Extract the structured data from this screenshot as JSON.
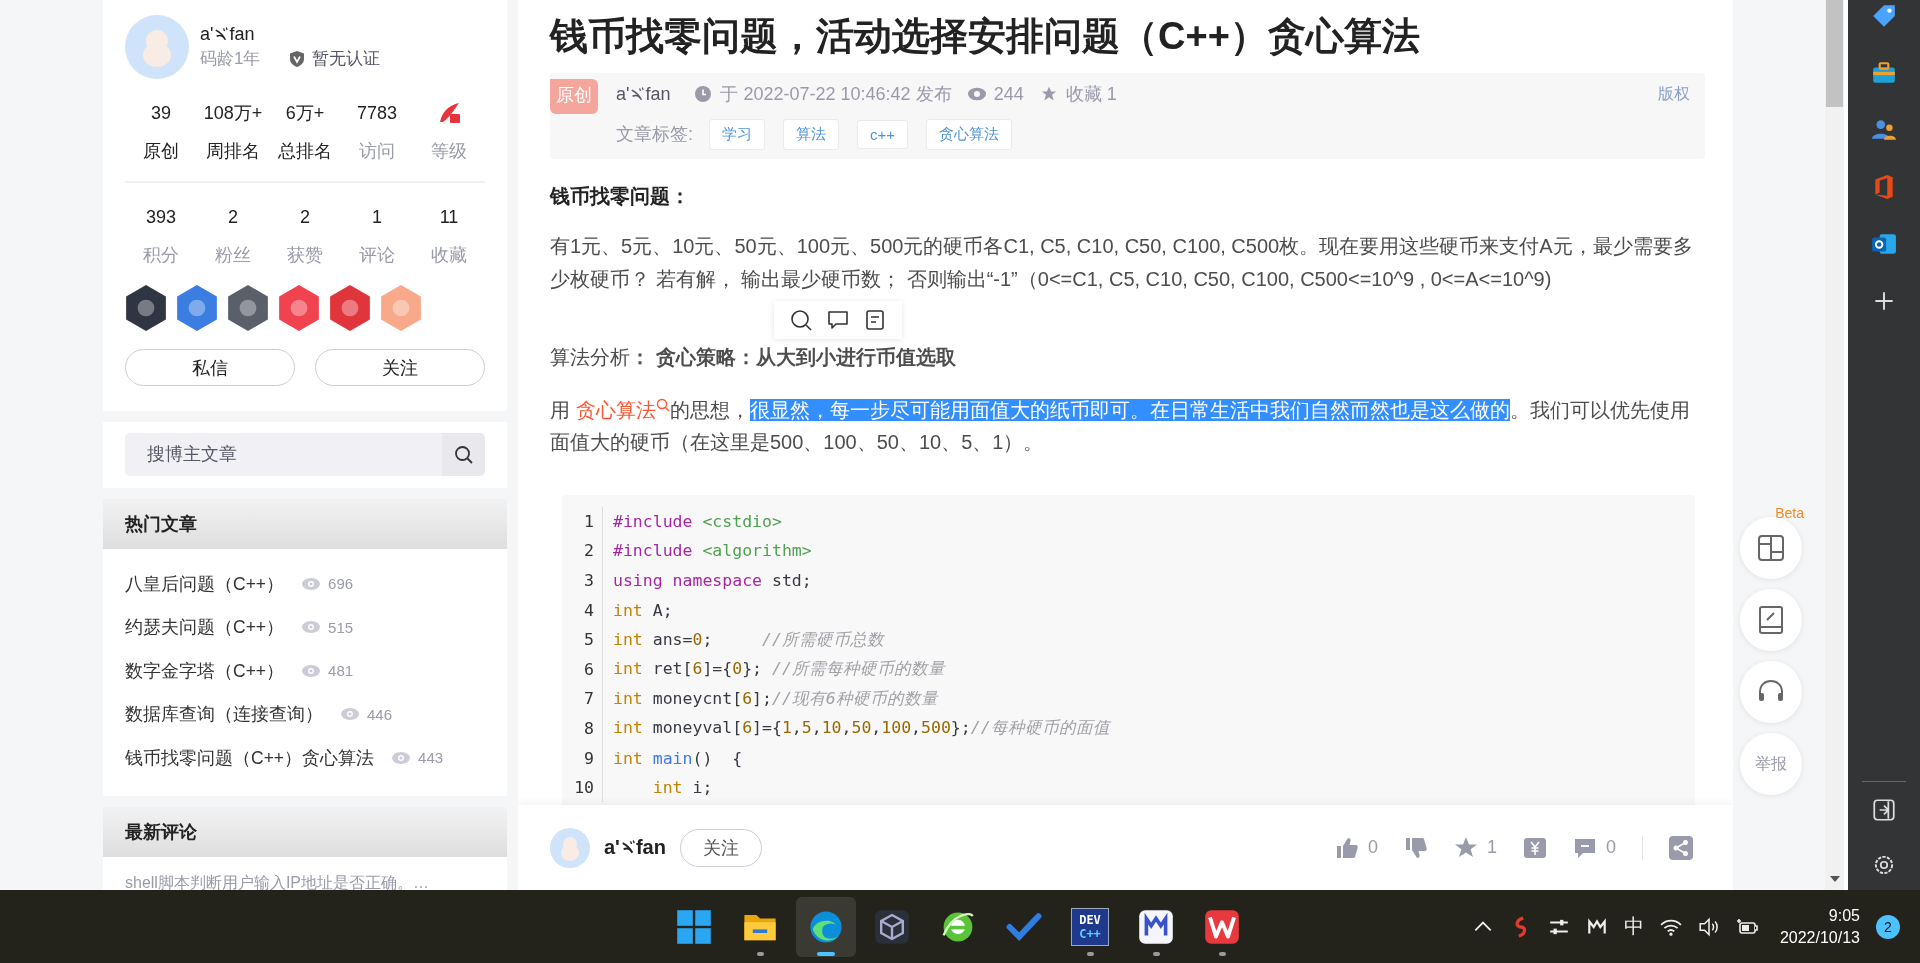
{
  "sidebar": {
    "profile": {
      "name": {
        "prefix": "a'",
        "suffix": "fan"
      },
      "code_age": "码龄1年",
      "certification": "暂无认证",
      "stats": [
        {
          "value": "39",
          "label": "原创",
          "linked": true
        },
        {
          "value": "108万+",
          "label": "周排名",
          "linked": true
        },
        {
          "value": "6万+",
          "label": "总排名",
          "linked": true
        },
        {
          "value": "7783",
          "label": "访问",
          "linked": false
        },
        {
          "kind": "level",
          "label": "等级",
          "linked": false
        }
      ],
      "stats2": [
        {
          "value": "393",
          "label": "积分"
        },
        {
          "value": "2",
          "label": "粉丝"
        },
        {
          "value": "2",
          "label": "获赞"
        },
        {
          "value": "1",
          "label": "评论"
        },
        {
          "value": "11",
          "label": "收藏"
        }
      ],
      "badges": [
        {
          "color": "#2f3542"
        },
        {
          "color": "#3b7de0"
        },
        {
          "color": "#5a5f6a"
        },
        {
          "color": "#f0434f"
        },
        {
          "color": "#e0353b"
        },
        {
          "color": "#f7a98a"
        }
      ],
      "buttons": [
        "私信",
        "关注"
      ]
    },
    "search": {
      "placeholder": "搜博主文章"
    },
    "hot": {
      "title": "热门文章",
      "items": [
        {
          "title": "八皇后问题（C++）",
          "views": "696"
        },
        {
          "title": "约瑟夫问题（C++）",
          "views": "515"
        },
        {
          "title": "数字金字塔（C++）",
          "views": "481"
        },
        {
          "title": "数据库查询（连接查询）",
          "views": "446"
        },
        {
          "title": "钱币找零问题（C++）贪心算法",
          "views": "443"
        }
      ]
    },
    "comments": {
      "title": "最新评论",
      "items": [
        "shell脚本判断用户输入IP地址是否正确。…"
      ]
    }
  },
  "article": {
    "title": "钱币找零问题，活动选择安排问题（C++）贪心算法",
    "badge": "原创",
    "author": {
      "prefix": "a'",
      "suffix": "fan"
    },
    "published": "于 2022-07-22 10:46:42 发布",
    "views": "244",
    "favorites": "收藏 1",
    "copyright": "版权",
    "tags_label": "文章标签:",
    "tags": [
      "学习",
      "算法",
      "c++",
      "贪心算法"
    ],
    "heading": "钱币找零问题：",
    "paragraph": "有1元、5元、10元、50元、100元、500元的硬币各C1, C5, C10, C50, C100, C500枚。现在要用这些硬币来支付A元，最少需要多少枚硬币？ 若有解， 输出最少硬币数； 否则输出“-1”（0<=C1, C5, C10, C50, C100, C500<=10^9 , 0<=A<=10^9)",
    "analysis": "算法分析**：  贪心策略：从大到小进行币值选取**",
    "idea": [
      {
        "kind": "text",
        "text": "用 ",
        "selected": false
      },
      {
        "kind": "link",
        "text": "贪心算法",
        "selected": false
      },
      {
        "kind": "text",
        "text": "的思想，",
        "selected": false
      },
      {
        "kind": "text",
        "text": "很显然，每一步尽可能用面值大的纸币即可。在日常生活中我们自然而然也是这么做的",
        "selected": true
      },
      {
        "kind": "text",
        "text": "。我们可以优先使用面值大的硬币（在这里是500、100、50、10、5、1）。",
        "selected": false
      }
    ],
    "code": [
      {
        "no": "1",
        "tokens": [
          {
            "kind": "meta",
            "text": "#include"
          },
          {
            "kind": "str",
            "text": " <cstdio>"
          }
        ]
      },
      {
        "no": "2",
        "tokens": [
          {
            "kind": "meta",
            "text": "#include"
          },
          {
            "kind": "str",
            "text": " <algorithm>"
          }
        ]
      },
      {
        "no": "3",
        "tokens": [
          {
            "kind": "kw",
            "text": "using"
          },
          {
            "kind": "kw",
            "text": " namespace"
          },
          {
            "kind": "plain",
            "text": " std;"
          }
        ]
      },
      {
        "no": "4",
        "tokens": [
          {
            "kind": "type",
            "text": "int"
          },
          {
            "kind": "plain",
            "text": " A;"
          }
        ]
      },
      {
        "no": "5",
        "tokens": [
          {
            "kind": "type",
            "text": "int"
          },
          {
            "kind": "plain",
            "text": " ans="
          },
          {
            "kind": "num",
            "text": "0"
          },
          {
            "kind": "plain",
            "text": ";     "
          },
          {
            "kind": "com",
            "text": "//所需硬币总数"
          }
        ]
      },
      {
        "no": "6",
        "tokens": [
          {
            "kind": "type",
            "text": "int"
          },
          {
            "kind": "plain",
            "text": " ret["
          },
          {
            "kind": "num",
            "text": "6"
          },
          {
            "kind": "plain",
            "text": "]={"
          },
          {
            "kind": "num",
            "text": "0"
          },
          {
            "kind": "plain",
            "text": "}; "
          },
          {
            "kind": "com",
            "text": "//所需每种硬币的数量"
          }
        ]
      },
      {
        "no": "7",
        "tokens": [
          {
            "kind": "type",
            "text": "int"
          },
          {
            "kind": "plain",
            "text": " moneycnt["
          },
          {
            "kind": "num",
            "text": "6"
          },
          {
            "kind": "plain",
            "text": "];"
          },
          {
            "kind": "com",
            "text": "//现有6种硬币的数量"
          }
        ]
      },
      {
        "no": "8",
        "tokens": [
          {
            "kind": "type",
            "text": "int"
          },
          {
            "kind": "plain",
            "text": " moneyval["
          },
          {
            "kind": "num",
            "text": "6"
          },
          {
            "kind": "plain",
            "text": "]={"
          },
          {
            "kind": "num",
            "text": "1"
          },
          {
            "kind": "plain",
            "text": ","
          },
          {
            "kind": "num",
            "text": "5"
          },
          {
            "kind": "plain",
            "text": ","
          },
          {
            "kind": "num",
            "text": "10"
          },
          {
            "kind": "plain",
            "text": ","
          },
          {
            "kind": "num",
            "text": "50"
          },
          {
            "kind": "plain",
            "text": ","
          },
          {
            "kind": "num",
            "text": "100"
          },
          {
            "kind": "plain",
            "text": ","
          },
          {
            "kind": "num",
            "text": "500"
          },
          {
            "kind": "plain",
            "text": "};"
          },
          {
            "kind": "com",
            "text": "//每种硬币的面值"
          }
        ]
      },
      {
        "no": "9",
        "tokens": [
          {
            "kind": "type",
            "text": "int"
          },
          {
            "kind": "fn",
            "text": " main"
          },
          {
            "kind": "plain",
            "text": "()  {"
          }
        ]
      },
      {
        "no": "10",
        "tokens": [
          {
            "kind": "type",
            "text": "    int"
          },
          {
            "kind": "plain",
            "text": " i;"
          }
        ]
      }
    ],
    "footer": {
      "author": {
        "prefix": "a'",
        "suffix": "fan"
      },
      "follow": "关注",
      "actions": [
        {
          "kind": "like",
          "count": "0"
        },
        {
          "kind": "dislike"
        },
        {
          "kind": "favorite",
          "count": "1"
        },
        {
          "kind": "reward"
        },
        {
          "kind": "comment",
          "count": "0"
        },
        {
          "kind": "share"
        }
      ]
    }
  },
  "float_tools": {
    "beta": "Beta",
    "items": [
      {
        "kind": "layout"
      },
      {
        "kind": "notebook"
      },
      {
        "kind": "headset"
      },
      {
        "kind": "report",
        "text": "举报"
      }
    ]
  },
  "edge_sidebar": {
    "items": [
      {
        "kind": "tag"
      },
      {
        "kind": "briefcase"
      },
      {
        "kind": "people"
      },
      {
        "kind": "office"
      },
      {
        "kind": "outlook"
      },
      {
        "kind": "plus"
      }
    ]
  },
  "taskbar": {
    "apps": [
      {
        "kind": "windows",
        "running": false,
        "active": false
      },
      {
        "kind": "folder",
        "running": true,
        "active": false
      },
      {
        "kind": "edge",
        "running": true,
        "active": true
      },
      {
        "kind": "cube",
        "running": false,
        "active": false
      },
      {
        "kind": "ie",
        "running": false,
        "active": false
      },
      {
        "kind": "todo",
        "running": false,
        "active": false
      },
      {
        "kind": "devcpp",
        "running": true,
        "active": false,
        "logo": [
          "DEV",
          "C++"
        ]
      },
      {
        "kind": "mark",
        "running": true,
        "active": false
      },
      {
        "kind": "wps",
        "running": true,
        "active": false
      }
    ],
    "ime": "中",
    "time": "9:05",
    "date": "2022/10/13",
    "notifications": "2"
  }
}
